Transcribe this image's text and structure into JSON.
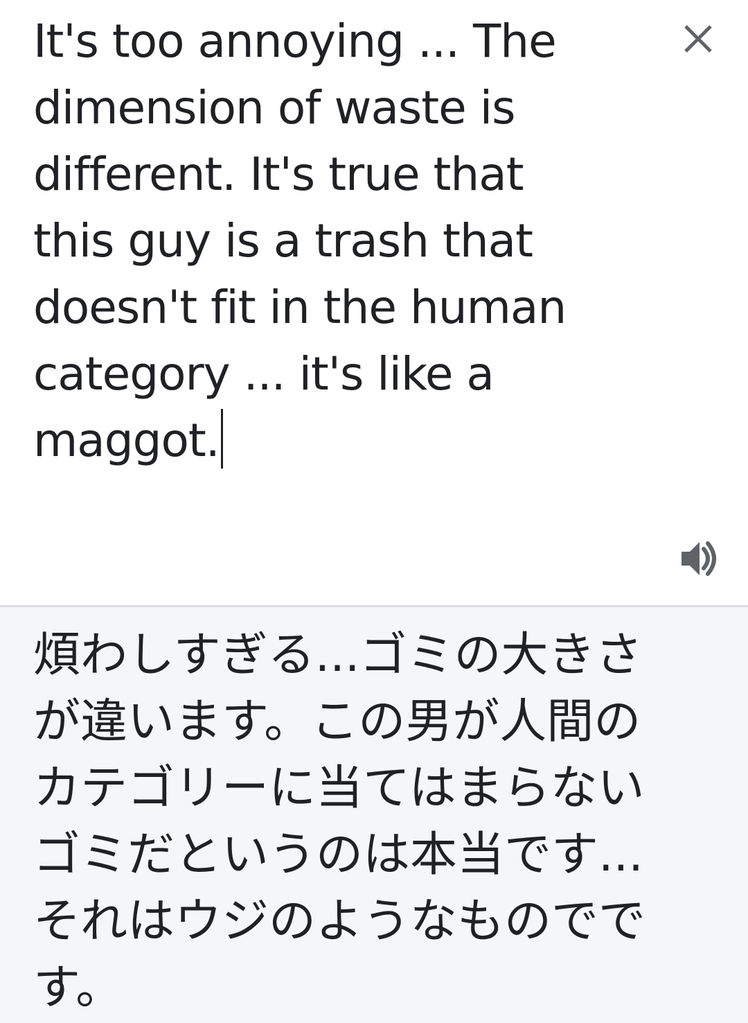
{
  "source": {
    "lines": [
      "It's too annoying ... The",
      "dimension of waste is",
      "different. It's true that",
      "this guy is a trash that",
      "doesn't fit in the human",
      "category ... it's like a",
      "maggot."
    ]
  },
  "target": {
    "lines": [
      "煩わしすぎる...ゴミの大きさ",
      "が違います。この男が人間の",
      "カテゴリーに当てはまらない",
      "ゴミだというのは本当です...",
      "それはウジのようなものでで",
      "す。"
    ]
  },
  "icons": {
    "close": "close-icon",
    "speaker": "volume-icon"
  },
  "colors": {
    "text": "#202124",
    "icon": "#5f6368",
    "target_bg": "#f5f6f7",
    "divider": "#dadce0"
  }
}
